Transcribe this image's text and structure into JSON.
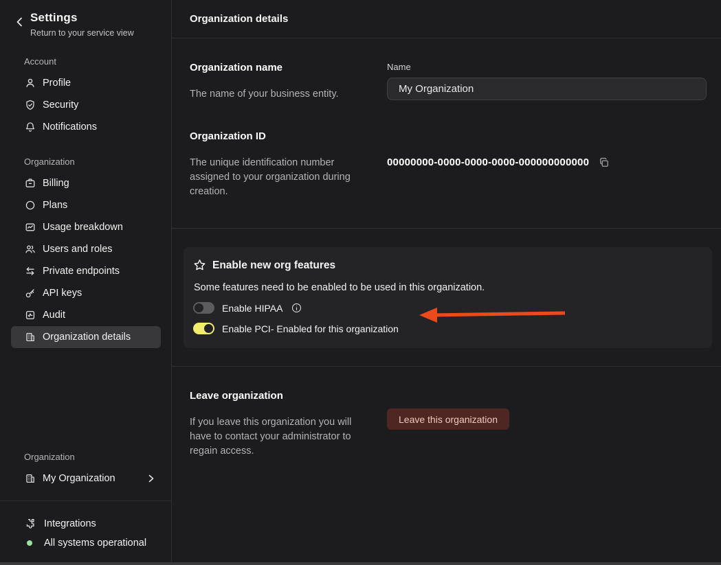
{
  "sidebar": {
    "title": "Settings",
    "subtitle": "Return to your service view",
    "sections": [
      {
        "label": "Account",
        "items": [
          {
            "label": "Profile",
            "icon": "user-icon"
          },
          {
            "label": "Security",
            "icon": "shield-check-icon"
          },
          {
            "label": "Notifications",
            "icon": "bell-icon"
          }
        ]
      },
      {
        "label": "Organization",
        "items": [
          {
            "label": "Billing",
            "icon": "billing-icon"
          },
          {
            "label": "Plans",
            "icon": "circle-icon"
          },
          {
            "label": "Usage breakdown",
            "icon": "usage-chart-icon"
          },
          {
            "label": "Users and roles",
            "icon": "users-icon"
          },
          {
            "label": "Private endpoints",
            "icon": "swap-arrows-icon"
          },
          {
            "label": "API keys",
            "icon": "key-icon"
          },
          {
            "label": "Audit",
            "icon": "audit-icon"
          },
          {
            "label": "Organization details",
            "icon": "building-icon",
            "selected": true
          }
        ]
      }
    ],
    "org_switcher": {
      "label": "Organization",
      "name": "My Organization",
      "icon": "building-icon"
    },
    "footer": {
      "integrations": "Integrations",
      "status": "All systems operational",
      "status_color": "#9be29f"
    }
  },
  "header": {
    "title": "Organization details"
  },
  "sections": {
    "org_name": {
      "title": "Organization name",
      "description": "The name of your business entity.",
      "field_label": "Name",
      "field_value": "My Organization"
    },
    "org_id": {
      "title": "Organization ID",
      "description": "The unique identification number assigned to your organization during creation.",
      "value": "00000000-0000-0000-0000-000000000000"
    },
    "features": {
      "title": "Enable new org features",
      "description": "Some features need to be enabled to be used in this organization.",
      "toggles": [
        {
          "label": "Enable HIPAA",
          "state": "off",
          "has_info": true
        },
        {
          "label": "Enable PCI- Enabled for this organization",
          "state": "on"
        }
      ],
      "toggle_on_color": "#f2ee6b",
      "arrow_color": "#ea4a1c"
    },
    "leave": {
      "title": "Leave organization",
      "description": "If you leave this organization you will have to contact your administrator to regain access.",
      "button_label": "Leave this organization",
      "button_bg": "#4f2722",
      "button_text_color": "#f3c6c0"
    }
  }
}
